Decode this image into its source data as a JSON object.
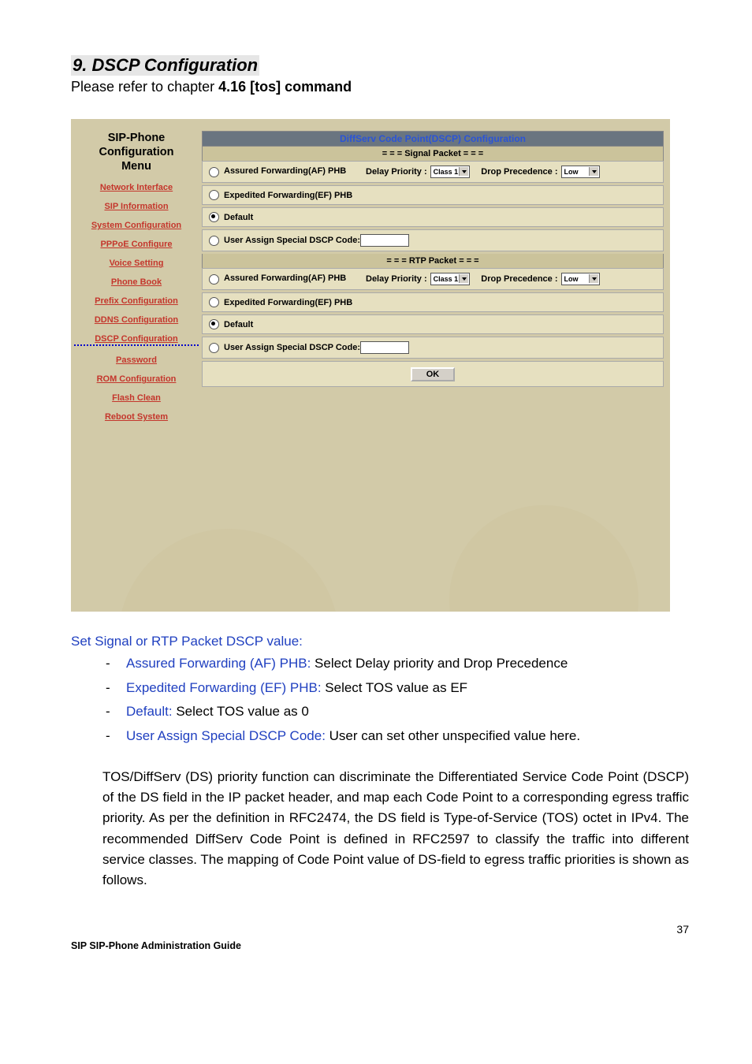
{
  "heading": "9. DSCP Configuration",
  "subline_pre": "Please refer to chapter ",
  "subline_bold": "4.16 [tos] command",
  "sidebar": {
    "title_l1": "SIP-Phone",
    "title_l2": "Configuration",
    "title_l3": "Menu",
    "links": [
      "Network Interface",
      "SIP Information",
      "System Configuration",
      "PPPoE Configure",
      "Voice Setting",
      "Phone Book",
      "Prefix Configuration",
      "DDNS Configuration",
      "DSCP Configuration",
      "Password",
      "ROM Configuration",
      "Flash Clean",
      "Reboot System"
    ]
  },
  "panel": {
    "title": "DiffServ Code Point(DSCP) Configuration",
    "sections": [
      {
        "head": "= = = Signal Packet = = =",
        "af_label": "Assured Forwarding(AF) PHB",
        "delay_lbl": "Delay Priority :",
        "delay_val": "Class 1",
        "drop_lbl": "Drop Precedence :",
        "drop_val": "Low",
        "ef_label": "Expedited Forwarding(EF) PHB",
        "default_label": "Default",
        "user_label": "User Assign Special DSCP Code:"
      },
      {
        "head": "= = = RTP Packet = = =",
        "af_label": "Assured Forwarding(AF) PHB",
        "delay_lbl": "Delay Priority :",
        "delay_val": "Class 1",
        "drop_lbl": "Drop Precedence :",
        "drop_val": "Low",
        "ef_label": "Expedited Forwarding(EF) PHB",
        "default_label": "Default",
        "user_label": "User Assign Special DSCP Code:"
      }
    ],
    "ok": "OK"
  },
  "body": {
    "intro": "Set Signal or RTP Packet DSCP value:",
    "items": [
      {
        "blue": "Assured Forwarding (AF) PHB:",
        "rest": " Select Delay priority and Drop Precedence"
      },
      {
        "blue": "Expedited Forwarding (EF) PHB:",
        "rest": " Select TOS value as EF"
      },
      {
        "blue": "Default:",
        "rest": " Select TOS value as 0"
      },
      {
        "blue": "User Assign Special DSCP Code:",
        "rest": " User can set other unspecified value here."
      }
    ],
    "para": "TOS/DiffServ (DS) priority function can discriminate the Differentiated Service Code Point (DSCP) of the DS field in the IP packet header, and map each Code Point to a corresponding egress traffic priority. As per the definition in RFC2474, the DS field is Type-of-Service (TOS) octet in IPv4. The recommended DiffServ Code Point is defined in RFC2597 to classify the traffic into different service classes. The mapping of Code Point value of DS-field to egress traffic priorities is shown as follows."
  },
  "pagenum": "37",
  "footer": "SIP SIP-Phone    Administration Guide"
}
